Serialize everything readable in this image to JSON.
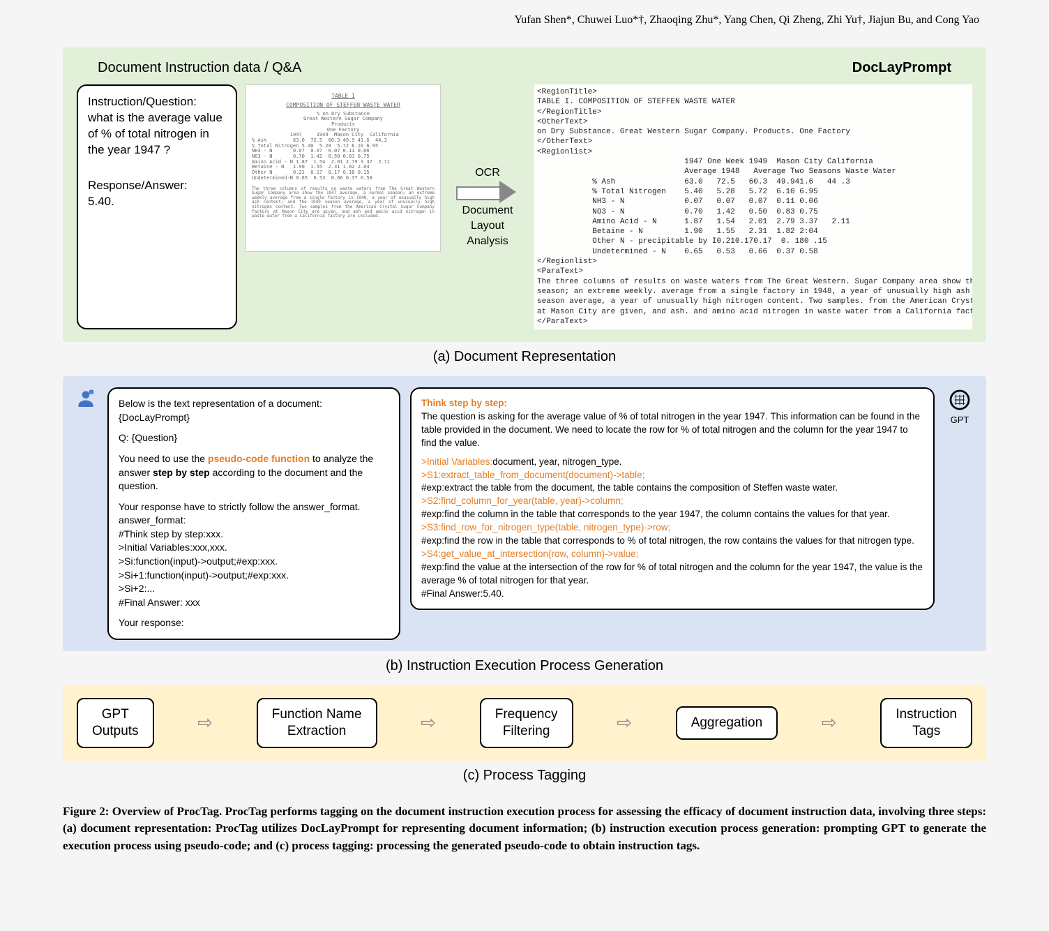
{
  "authors": "Yufan Shen*, Chuwei Luo*†, Zhaoqing Zhu*, Yang Chen, Qi Zheng, Zhi Yu†, Jiajun Bu, and Cong Yao",
  "panelA": {
    "leftTitle": "Document Instruction data / Q&A",
    "rightTitle": "DocLayPrompt",
    "qa": {
      "questionLabel": "Instruction/Question:",
      "question": "what is the average value of % of total nitrogen in the year 1947 ?",
      "answerLabel": "Response/Answer:",
      "answer": "5.40."
    },
    "docImg": {
      "title1": "TABLE I",
      "title2": "COMPOSITION OF STEFFEN WASTE WATER",
      "sub1": "% on Dry Substance",
      "sub2": "Great Western Sugar Company",
      "sub3": "Products",
      "sub4": "One Factory",
      "header": "             1947     1949  Mason City  California",
      "rows": "% Ash         63.0  72.5  60.3 49.9 41.6  44.3\n% Total Nitrogen 5.40  5.28  5.72 6.10 6.95\nNH3 - N       0.07  0.07  0.07 0.11 0.06\nNO3 - N       0.70  1.42  0.50 0.83 0.75\nAmino Acid - N 1.87  1.54  2.01 2.79 3.37  2.11\nBetaine - N   1.90  1.55  2.31 1.82 2.04\nOther N       0.21  0.17  0.17 0.18 0.15\nUndetermined-N 0.65  0.53  0.66 0.37 0.58",
      "para": "The three columns of results on waste waters from The Great Western Sugar Company area show the 1947 average, a normal season; an extreme weekly average from a single factory in 1948, a year of unusually high ash content; and the 1949 season average, a year of unusually high nitrogen content. Two samples from the American Crystal Sugar Company factory at Mason City are given, and ash and amino acid nitrogen in waste water from a California factory are included."
    },
    "arrow": {
      "top": "OCR",
      "bot1": "Document",
      "bot2": "Layout",
      "bot3": "Analysis"
    },
    "doclay": "<RegionTitle>\nTABLE I. COMPOSITION OF STEFFEN WASTE WATER\n</RegionTitle>\n<OtherText>\non Dry Substance. Great Western Sugar Company. Products. One Factory\n</OtherText>\n<Regionlist>\n                                1947 One Week 1949  Mason City California\n                                Average 1948   Average Two Seasons Waste Water\n            % Ash               63.0   72.5   60.3  49.941.6   44 .3\n            % Total Nitrogen    5.40   5.28   5.72  6.10 6.95\n            NH3 - N             0.07   0.07   0.07  0.11 0.06\n            NO3 - N             0.70   1.42   0.50  0.83 0.75\n            Amino Acid - N      1.87   1.54   2.01  2.79 3.37   2.11\n            Betaine - N         1.90   1.55   2.31  1.82 2:04\n            Other N - precipitable by I0.210.170.17  0. 180 .15\n            Undetermined - N    0.65   0.53   0.66  0.37 0.58\n</Regionlist>\n<ParaText>\nThe three columns of results on waste waters from The Great Western. Sugar Company area show the 1947 average, a normal\nseason; an extreme weekly. average from a single factory in 1948, a year of unusually high ash content; and. the 1949\nseason average, a year of unusually high nitrogen content. Two samples. from the American Crystal Sugar Company factory\nat Mason City are given, and ash. and amino acid nitrogen in waste water from a California factory are included.\n</ParaText>",
    "caption": "(a) Document Representation"
  },
  "panelB": {
    "prompt": {
      "l1": "Below is the text representation of a document:",
      "l2": "{DocLayPrompt}",
      "l3": "Q: {Question}",
      "l4a": "You need to use the ",
      "l4b": "pseudo-code function",
      "l4c": " to analyze the answer ",
      "l4d": "step by step",
      "l4e": " according to the document and the question.",
      "l5": "Your response have to strictly follow the answer_format.",
      "l6": "answer_format:",
      "l7": "#Think step by step:xxx.",
      "l8": ">Initial Variables:xxx,xxx.",
      "l9": ">Si:function(input)->output;#exp:xxx.",
      "l10": ">Si+1:function(input)->output;#exp:xxx.",
      "l11": ">Si+2:...",
      "l12": "#Final Answer: xxx",
      "l13": "Your response:"
    },
    "response": {
      "r1a": "Think step by step:",
      "r1b": "The question is asking for the average value of % of total nitrogen in the year 1947. This information can be found in the table provided in the document. We need to locate the row for % of total nitrogen and the column for the year 1947 to find the value.",
      "r2a": ">Initial Variables:",
      "r2b": "document, year, nitrogen_type.",
      "r3": ">S1:extract_table_from_document(document)->table;",
      "r3e": "#exp:extract the table from the document, the table contains the composition of Steffen waste water.",
      "r4": ">S2:find_column_for_year(table, year)->column;",
      "r4e": "#exp:find the column in the table that corresponds to the year 1947, the column contains the values for that year.",
      "r5": ">S3:find_row_for_nitrogen_type(table, nitrogen_type)->row;",
      "r5e": "#exp:find the row in the table that corresponds to % of total nitrogen, the row contains the values for that nitrogen type.",
      "r6": ">S4:get_value_at_intersection(row, column)->value;",
      "r6e": "#exp:find the value at the intersection of the row for % of total nitrogen and the column for the year 1947, the value is the average % of total nitrogen for that year.",
      "r7": "#Final Answer:5.40."
    },
    "gptLabel": "GPT",
    "caption": "(b) Instruction Execution Process Generation"
  },
  "panelC": {
    "s1": "GPT\nOutputs",
    "s2": "Function Name\nExtraction",
    "s3": "Frequency\nFiltering",
    "s4": "Aggregation",
    "s5": "Instruction\nTags",
    "caption": "(c) Process Tagging"
  },
  "figcap": {
    "num": "Figure 2: Overview of ProcTag. ",
    "text": "ProcTag performs tagging on the document instruction execution process for assessing the efficacy of document instruction data, involving three steps: (a) document representation: ProcTag utilizes DocLayPrompt for representing document information; (b) instruction execution process generation: prompting GPT to generate the execution process using pseudo-code; and (c) process tagging: processing the generated pseudo-code to obtain instruction tags."
  }
}
